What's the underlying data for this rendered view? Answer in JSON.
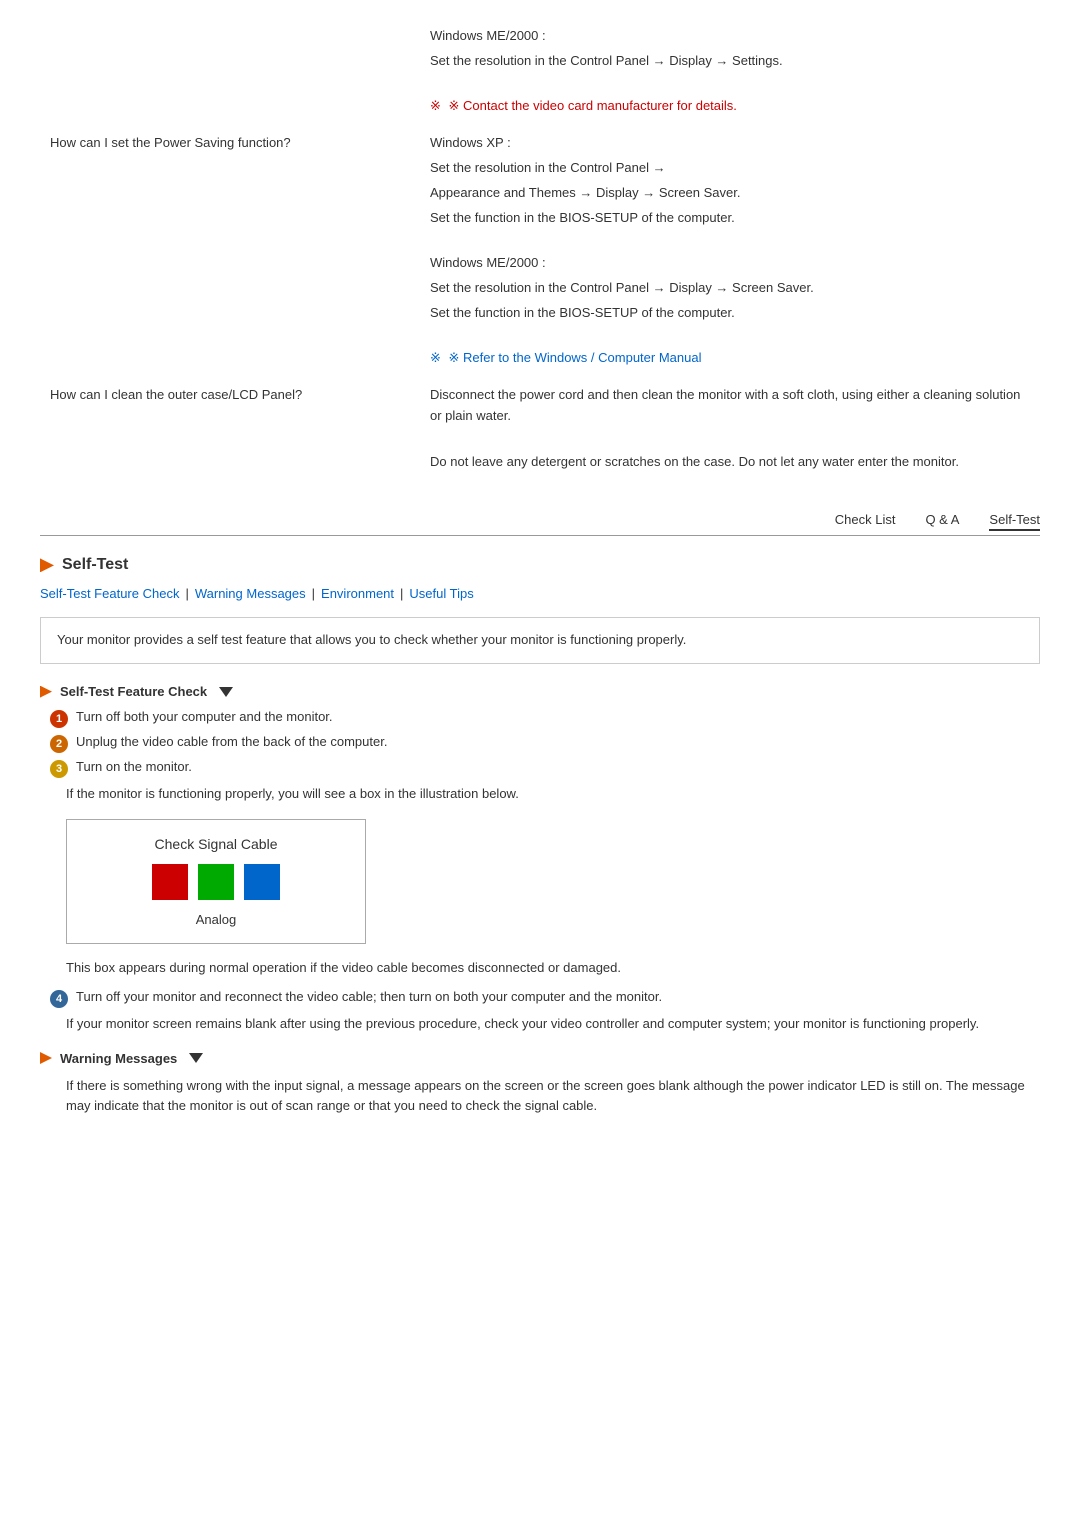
{
  "faq": {
    "rows": [
      {
        "question": "",
        "answers": [
          "Windows ME/2000 :",
          "Set the resolution in the Control Panel → Display → Settings.",
          "",
          "※  Contact the video card manufacturer for details."
        ],
        "note_index": 3,
        "note_color": "red"
      },
      {
        "question": "How can I set the Power Saving function?",
        "answers": [
          "Windows XP :",
          "Set the resolution in the Control Panel →",
          "Appearance and Themes → Display → Screen Saver.",
          "Set the function in the BIOS-SETUP of the computer.",
          "",
          "Windows ME/2000 :",
          "Set the resolution in the Control Panel → Display → Screen Saver.",
          "Set the function in the BIOS-SETUP of the computer.",
          "",
          "※  Refer to the Windows / Computer Manual"
        ],
        "note_index": 9,
        "note_color": "blue"
      },
      {
        "question": "How can I clean the outer case/LCD Panel?",
        "answers": [
          "Disconnect the power cord and then clean the monitor with a soft cloth, using either a cleaning solution or plain water.",
          "",
          "Do not leave any detergent or scratches on the case. Do not let any water enter the monitor."
        ],
        "note_index": -1,
        "note_color": ""
      }
    ]
  },
  "nav_tabs": {
    "items": [
      "Check List",
      "Q & A",
      "Self-Test"
    ],
    "active": "Self-Test"
  },
  "self_test": {
    "section_title": "Self-Test",
    "sub_nav": [
      {
        "label": "Self-Test Feature Check",
        "separator": "|"
      },
      {
        "label": "Warning Messages",
        "separator": "|"
      },
      {
        "label": "Environment",
        "separator": "|"
      },
      {
        "label": "Useful Tips",
        "separator": ""
      }
    ],
    "info_box": "Your monitor provides a self test feature that allows you to check whether your monitor is functioning properly.",
    "feature_check": {
      "title": "Self-Test Feature Check",
      "steps": [
        {
          "num": "1",
          "cls": "n1",
          "text": "Turn off both your computer and the monitor."
        },
        {
          "num": "2",
          "cls": "n2",
          "text": "Unplug the video cable from the back of the computer."
        },
        {
          "num": "3",
          "cls": "n3",
          "text": "Turn on the monitor."
        }
      ],
      "step3_note": "If the monitor is functioning properly, you will see a box in the illustration below.",
      "illustration": {
        "title": "Check Signal Cable",
        "subtitle": "Analog",
        "colors": [
          "#cc0000",
          "#00aa00",
          "#0066cc"
        ]
      },
      "box_note": "This box appears during normal operation if the video cable becomes disconnected or damaged.",
      "step4": {
        "num": "4",
        "cls": "n4",
        "text": "Turn off your monitor and reconnect the video cable; then turn on both your computer and the monitor."
      },
      "step4_note": "If your monitor screen remains blank after using the previous procedure, check your video controller and computer system; your monitor is functioning properly."
    },
    "warning_messages": {
      "title": "Warning Messages",
      "text": "If there is something wrong with the input signal, a message appears on the screen or the screen goes blank although the power indicator LED is still on. The message may indicate that the monitor is out of scan range or that you need to check the signal cable."
    }
  }
}
